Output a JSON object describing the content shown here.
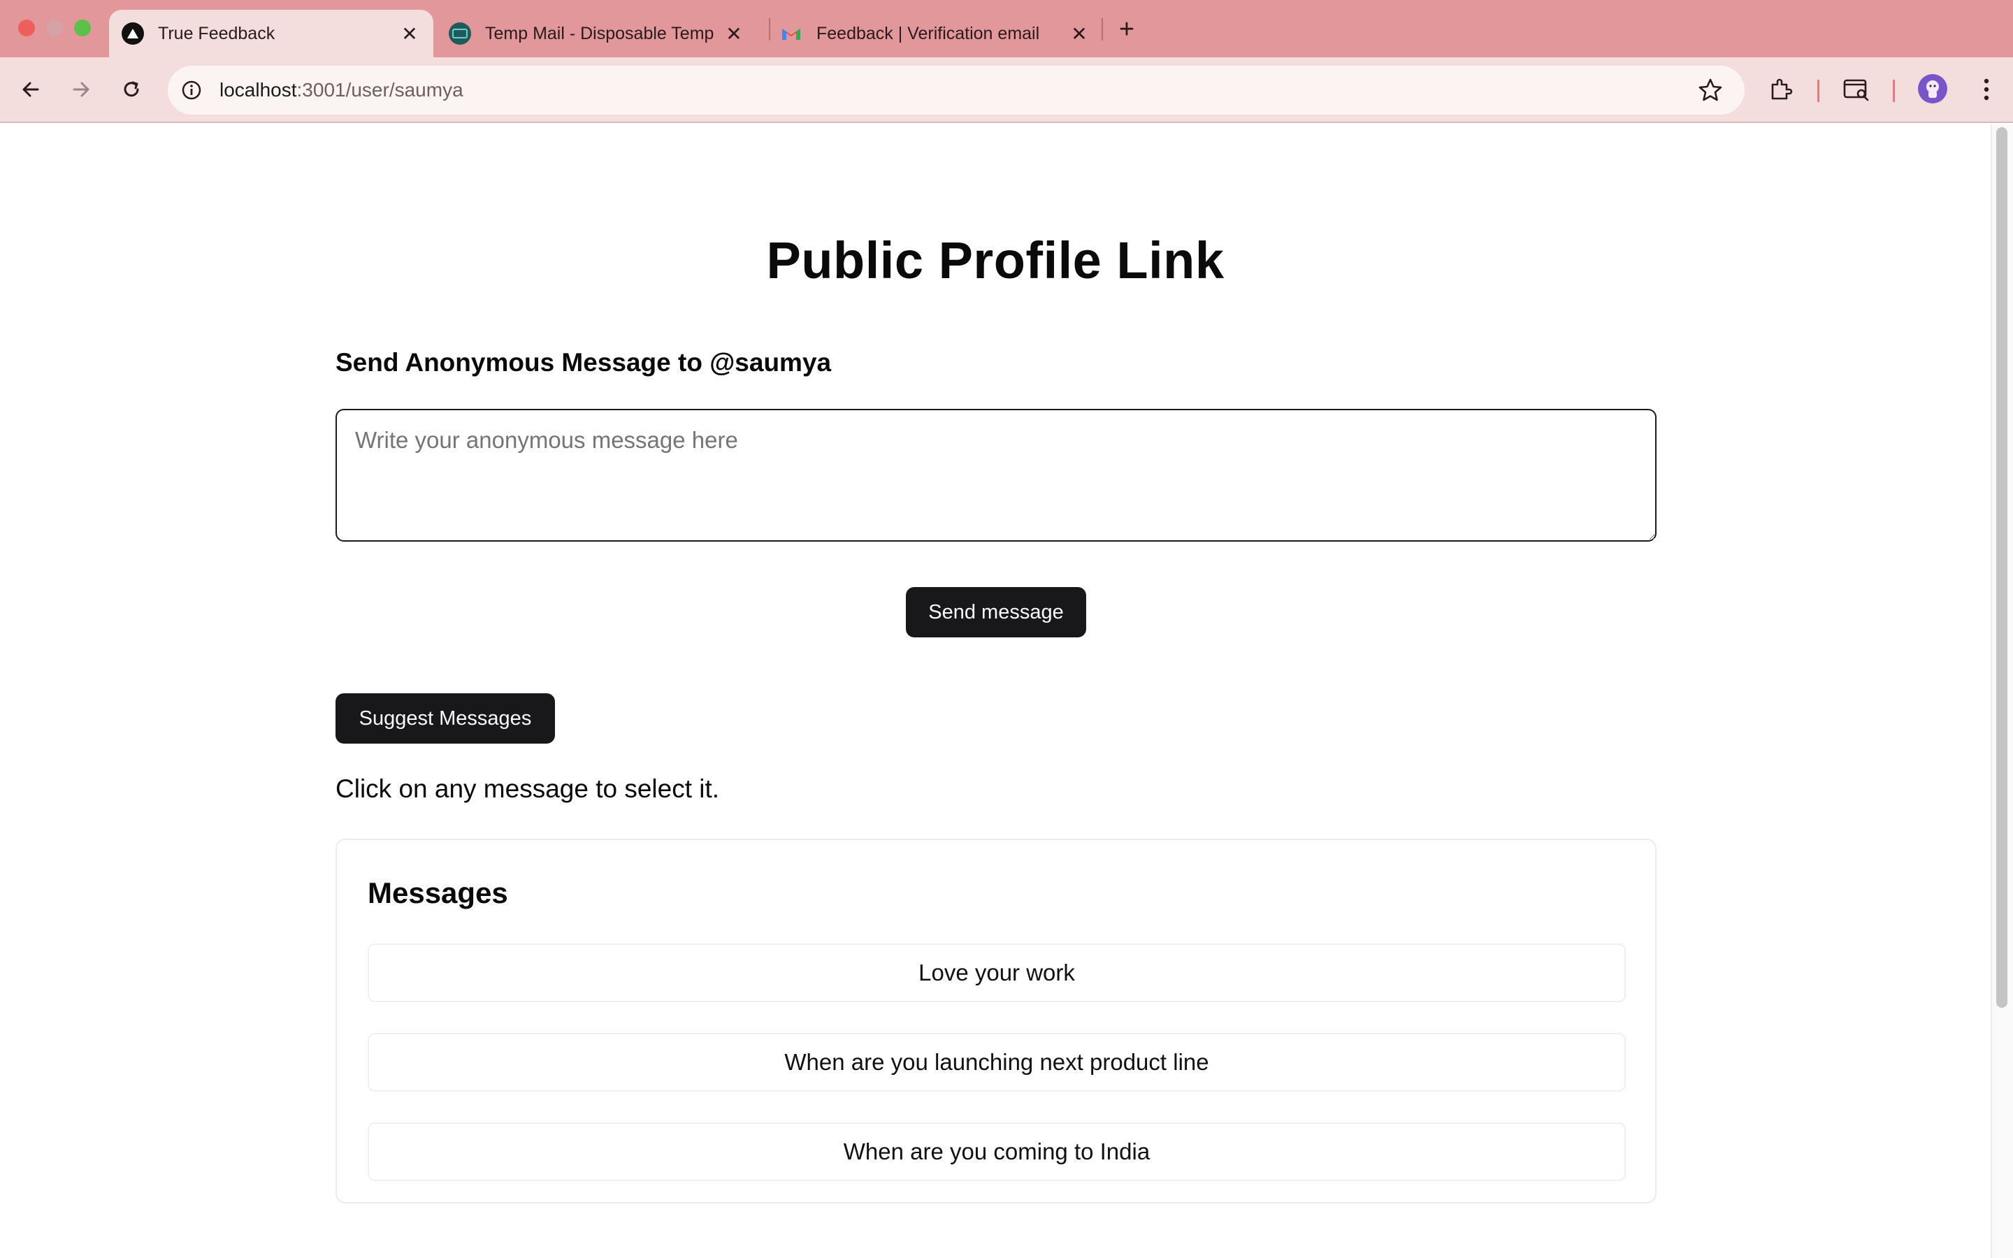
{
  "browser": {
    "tabs": [
      {
        "title": "True Feedback",
        "active": true,
        "favicon": "triangle-logo-icon"
      },
      {
        "title": "Temp Mail - Disposable Temp",
        "active": false,
        "favicon": "temp-mail-icon"
      },
      {
        "title": "Feedback | Verification email",
        "active": false,
        "favicon": "gmail-icon"
      }
    ],
    "tab_close_glyph": "✕",
    "new_tab_glyph": "+",
    "url_host": "localhost",
    "url_path": ":3001/user/saumya",
    "colors": {
      "tabstrip": "#e2979a",
      "toolbar": "#f3dddd",
      "button_dark": "#18181b"
    }
  },
  "page": {
    "title": "Public Profile Link",
    "send_heading": "Send Anonymous Message to @saumya",
    "message_input": {
      "value": "",
      "placeholder": "Write your anonymous message here"
    },
    "send_button_label": "Send message",
    "suggest_button_label": "Suggest Messages",
    "hint": "Click on any message to select it.",
    "messages_card": {
      "title": "Messages",
      "items": [
        "Love your work",
        "When are you launching next product line",
        "When are you coming to India"
      ]
    }
  }
}
